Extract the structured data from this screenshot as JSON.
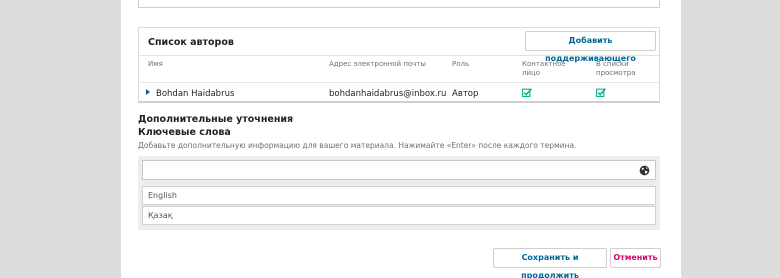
{
  "authors_list": {
    "title": "Список авторов",
    "add_button_label": "Добавить поддерживающего",
    "columns": {
      "name": "Имя",
      "email": "Адрес электронной почты",
      "role": "Роль",
      "contact_line1": "Контактное",
      "contact_line2": "лицо",
      "browse_line1": "В списки",
      "browse_line2": "просмотра"
    },
    "rows": [
      {
        "name": "Bohdan Haidabrus",
        "email": "bohdanhaidabrus@inbox.ru",
        "role": "Автор",
        "primary_contact_icon": "check-icon",
        "in_browse_list_icon": "check-icon"
      }
    ]
  },
  "additional": {
    "section_title": "Дополнительные уточнения",
    "keywords_title": "Ключевые слова",
    "keywords_description": "Добавьте дополнительную информацию для вашего материала. Нажимайте «Enter» после каждого термина.",
    "keywords_value": "",
    "globe_icon": "globe-icon",
    "languages": [
      "English",
      "Қазақ"
    ]
  },
  "actions": {
    "save_label": "Сохранить и продолжить",
    "cancel_label": "Отменить"
  },
  "colors": {
    "accent": "#006798",
    "cancel": "#d00a6c",
    "check": "#00b28d"
  }
}
